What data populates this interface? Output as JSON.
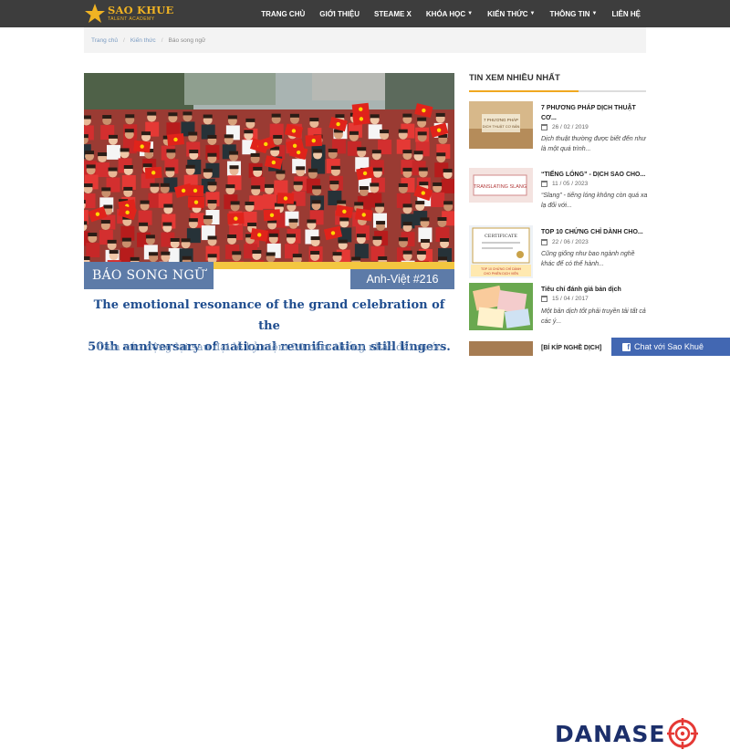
{
  "header": {
    "logo": {
      "main": "SAO KHUE",
      "sub": "TALENT ACADEMY",
      "icon": "star-icon"
    },
    "nav": [
      {
        "label": "TRANG CHỦ",
        "dropdown": false
      },
      {
        "label": "GIỚI THIỆU",
        "dropdown": false
      },
      {
        "label": "STEAME X",
        "dropdown": false
      },
      {
        "label": "KHÓA HỌC",
        "dropdown": true
      },
      {
        "label": "KIẾN THỨC",
        "dropdown": true
      },
      {
        "label": "THÔNG TIN",
        "dropdown": true
      },
      {
        "label": "LIÊN HỆ",
        "dropdown": false
      }
    ]
  },
  "breadcrumb": [
    "Trang chủ",
    "Kiến thức",
    "Báo song ngữ"
  ],
  "hero": {
    "label_left": "BÁO SONG NGỮ",
    "label_right": "Anh-Việt #216",
    "title_line1": "The emotional resonance of the grand celebration of the",
    "title_line2": "50th anniversary of national reunification still lingers.",
    "subtitle": "Cảm xúc động lại sau đại lễ kỷ niệm 50 năm thống nhất đất nước"
  },
  "sidebar": {
    "title": "TIN XEM NHIỀU NHẤT",
    "posts": [
      {
        "title": "7 PHƯƠNG PHÁP DỊCH THUẬT CƠ...",
        "date": "26 / 02 / 2019",
        "desc": "Dịch thuật thường được biết đến như là một quá trình...",
        "thumb_text": "7 PHƯƠNG PHÁP DỊCH THUẬT CƠ BẢN"
      },
      {
        "title": "“TIẾNG LÓNG” - DỊCH SAO CHO...",
        "date": "11 / 05 / 2023",
        "desc": "“Slang” - tiếng lóng không còn quá xa lạ đối với...",
        "thumb_text": "TRANSLATING SLANG"
      },
      {
        "title": "TOP 10 CHỨNG CHỈ DÀNH CHO...",
        "date": "22 / 06 / 2023",
        "desc": "Cũng giống như bao ngành nghề khác để có thể hành...",
        "thumb_text": "CERTIFICATE"
      },
      {
        "title": "Tiêu chí đánh giá bản dịch",
        "date": "15 / 04 / 2017",
        "desc": "Một bản dịch tốt phải truyền tải tất cả các ý...",
        "thumb_text": ""
      },
      {
        "title": "[BÍ KÍP NGHỀ DỊCH] Hướng dẫn",
        "date": "",
        "desc": "",
        "thumb_text": ""
      }
    ]
  },
  "chat": {
    "label": "Chat với Sao Khuê",
    "icon": "facebook-icon"
  },
  "watermark": {
    "text_a": "DANA",
    "text_b": "SE",
    "icon": "target-o-icon"
  },
  "colors": {
    "header_bg": "#3d3d3d",
    "accent_gold": "#f0b323",
    "label_blue": "#5d7ba8",
    "title_navy": "#1f4d8f",
    "chat_blue": "#4267b2"
  }
}
